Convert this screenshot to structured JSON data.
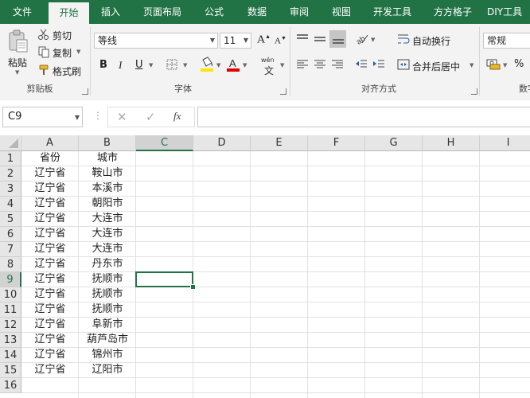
{
  "tabs": [
    "文件",
    "开始",
    "插入",
    "页面布局",
    "公式",
    "数据",
    "审阅",
    "视图",
    "开发工具",
    "方方格子",
    "DIY工具"
  ],
  "active_tab": "开始",
  "colors": {
    "accent": "#217346",
    "ribbon_bg": "#f3f3f3",
    "header_bg": "#e6e6e6",
    "grid_line": "#e1e1e1"
  },
  "clipboard": {
    "paste_label": "粘贴",
    "cut_label": "剪切",
    "copy_label": "复制",
    "format_painter_label": "格式刷",
    "group_label": "剪贴板"
  },
  "font": {
    "font_name": "等线",
    "font_size": "11",
    "bold": "B",
    "italic": "I",
    "underline": "U",
    "increase_size": "A",
    "decrease_size": "A",
    "phonetic_top": "wén",
    "phonetic_bottom": "文",
    "group_label": "字体"
  },
  "alignment": {
    "wrap_text_label": "自动换行",
    "merge_center_label": "合并后居中",
    "group_label": "对齐方式"
  },
  "number": {
    "format_value": "常规",
    "percent": "%",
    "group_label": "数字"
  },
  "formula_bar": {
    "name_box": "C9",
    "fx": "fx",
    "formula": ""
  },
  "sheet": {
    "columns": [
      "A",
      "B",
      "C",
      "D",
      "E",
      "F",
      "G",
      "H",
      "I"
    ],
    "selected_column": "C",
    "selected_row": 9,
    "selected_cell": "C9",
    "row_numbers": [
      1,
      2,
      3,
      4,
      5,
      6,
      7,
      8,
      9,
      10,
      11,
      12,
      13,
      14,
      15,
      16
    ],
    "rows": [
      [
        "省份",
        "城市"
      ],
      [
        "辽宁省",
        "鞍山市"
      ],
      [
        "辽宁省",
        "本溪市"
      ],
      [
        "辽宁省",
        "朝阳市"
      ],
      [
        "辽宁省",
        "大连市"
      ],
      [
        "辽宁省",
        "大连市"
      ],
      [
        "辽宁省",
        "大连市"
      ],
      [
        "辽宁省",
        "丹东市"
      ],
      [
        "辽宁省",
        "抚顺市"
      ],
      [
        "辽宁省",
        "抚顺市"
      ],
      [
        "辽宁省",
        "抚顺市"
      ],
      [
        "辽宁省",
        "阜新市"
      ],
      [
        "辽宁省",
        "葫芦岛市"
      ],
      [
        "辽宁省",
        "锦州市"
      ],
      [
        "辽宁省",
        "辽阳市"
      ],
      [
        "",
        ""
      ]
    ]
  }
}
